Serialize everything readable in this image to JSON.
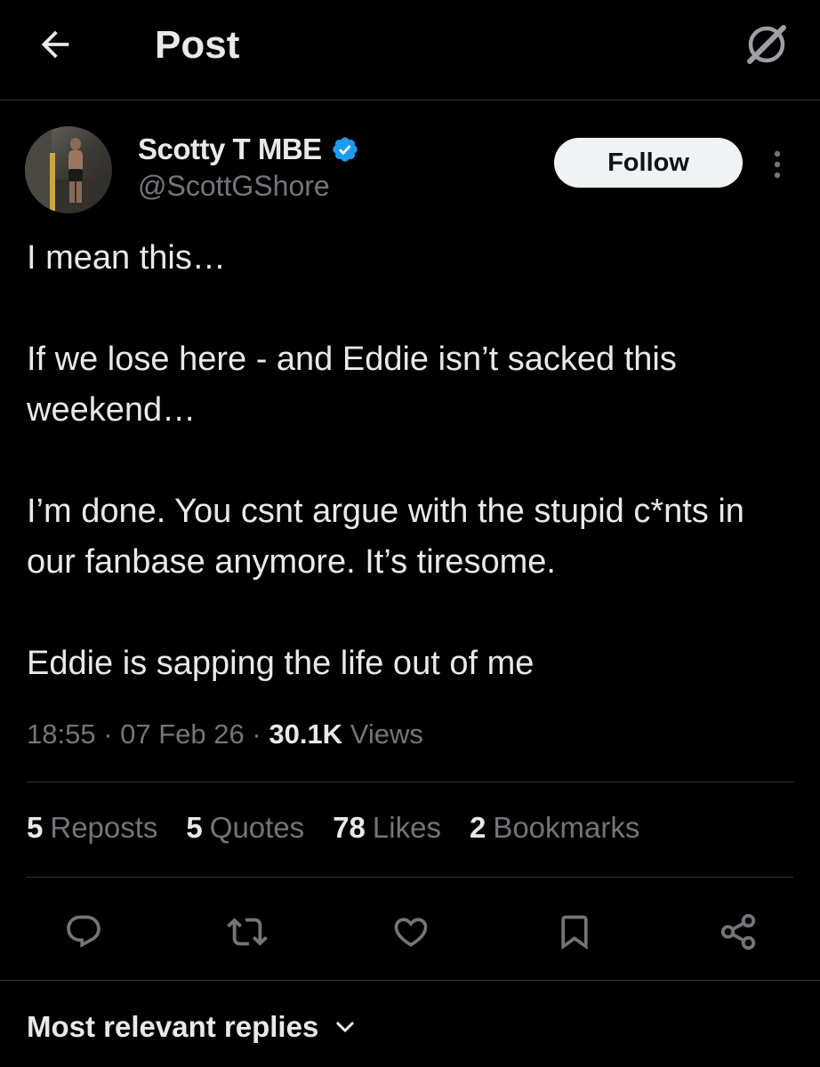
{
  "header": {
    "title": "Post",
    "back_icon": "arrow-left-icon",
    "grok_icon": "grok-icon"
  },
  "author": {
    "display_name": "Scotty T MBE",
    "handle": "@ScottGShore",
    "verified": true,
    "verified_color": "#1d9bf0",
    "follow_label": "Follow"
  },
  "tweet": {
    "paragraphs": [
      "I mean this…",
      "If we lose here - and Eddie isn’t sacked this weekend…",
      "I’m done. You csnt argue with the stupid c*nts in our fanbase anymore. It’s tiresome.",
      "Eddie is sapping the life out of me"
    ],
    "time": "18:55",
    "date": "07 Feb 26",
    "views_count": "30.1K",
    "views_label": "Views",
    "separator": "·"
  },
  "stats": {
    "reposts_count": "5",
    "reposts_label": "Reposts",
    "quotes_count": "5",
    "quotes_label": "Quotes",
    "likes_count": "78",
    "likes_label": "Likes",
    "bookmarks_count": "2",
    "bookmarks_label": "Bookmarks"
  },
  "actions": [
    "reply-icon",
    "repost-icon",
    "like-icon",
    "bookmark-icon",
    "share-icon"
  ],
  "replies_sort": {
    "label": "Most relevant replies"
  },
  "colors": {
    "background": "#000000",
    "text_primary": "#e7e9ea",
    "text_secondary": "#71767b",
    "divider": "#2f3336",
    "follow_button_bg": "#eff3f4"
  }
}
